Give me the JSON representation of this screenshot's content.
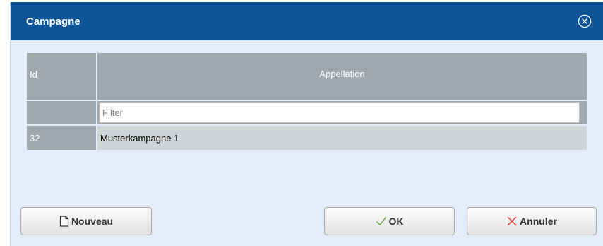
{
  "dialog": {
    "title": "Campagne",
    "close_icon": "close-circle-icon"
  },
  "grid": {
    "columns": [
      "Id",
      "Appellation"
    ],
    "filter_placeholder": "Filter",
    "rows": [
      {
        "id": "32",
        "appellation": "Musterkampagne 1"
      }
    ]
  },
  "buttons": {
    "new": {
      "label": "Nouveau",
      "icon": "document-icon"
    },
    "ok": {
      "label": "OK",
      "icon": "check-icon"
    },
    "cancel": {
      "label": "Annuler",
      "icon": "cross-icon"
    }
  },
  "colors": {
    "titlebar": "#0d5597",
    "dialog_bg": "#e3ecf8",
    "header_bg": "#a1a8ad",
    "row_bg": "#d1d4d6",
    "ok_green": "#6aa84f",
    "cancel_red": "#e0453a"
  }
}
